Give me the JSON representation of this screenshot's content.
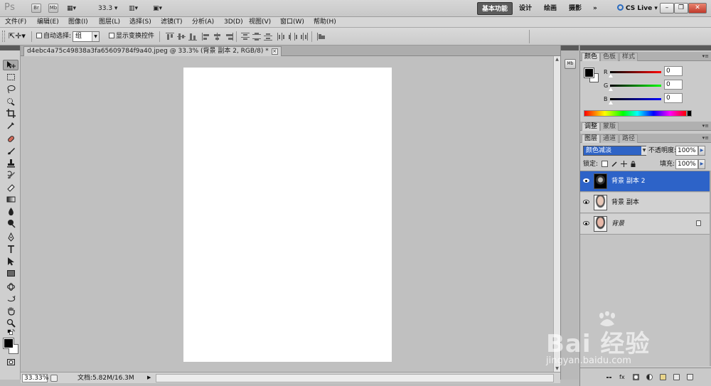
{
  "appbar": {
    "logo": "Ps",
    "bridge": "Br",
    "minibridge": "Mb",
    "zoom": "33.3",
    "workspaces": [
      "基本功能",
      "设计",
      "绘画",
      "摄影"
    ],
    "more": "»",
    "cs_live": "CS Live"
  },
  "menu": [
    "文件(F)",
    "编辑(E)",
    "图像(I)",
    "图层(L)",
    "选择(S)",
    "滤镜(T)",
    "分析(A)",
    "3D(D)",
    "视图(V)",
    "窗口(W)",
    "帮助(H)"
  ],
  "options": {
    "auto_select_label": "自动选择:",
    "auto_select_value": "组",
    "show_transform_label": "显示变换控件"
  },
  "document": {
    "tab_title": "d4ebc4a75c49838a3fa65609784f9a40.jpeg @ 33.3% (背景 副本 2, RGB/8) *",
    "tab_close": "×",
    "canvas_color": "#ffffff"
  },
  "status": {
    "zoom": "33.33%",
    "doc_info": "文档:5.82M/16.3M",
    "arrow": "▶"
  },
  "dock": {
    "minibridge": "Mb"
  },
  "color_panel": {
    "tabs": [
      "颜色",
      "色板",
      "样式"
    ],
    "channels": [
      {
        "label": "R",
        "value": "0"
      },
      {
        "label": "G",
        "value": "0"
      },
      {
        "label": "B",
        "value": "0"
      }
    ],
    "foreground": "#000000",
    "background": "#ffffff"
  },
  "adjust_panel": {
    "tabs": [
      "调整",
      "蒙版"
    ]
  },
  "layers_panel": {
    "tabs": [
      "图层",
      "通道",
      "路径"
    ],
    "blend_mode": "颜色减淡",
    "opacity_label": "不透明度:",
    "opacity_value": "100%",
    "lock_label": "锁定:",
    "fill_label": "填充:",
    "fill_value": "100%",
    "layers": [
      {
        "name": "背景 副本 2",
        "selected": true
      },
      {
        "name": "背景 副本",
        "selected": false
      },
      {
        "name": "背景",
        "selected": false,
        "locked": true
      }
    ]
  },
  "watermark": {
    "brand": "Bai  经验",
    "url": "jingyan.baidu.com"
  }
}
